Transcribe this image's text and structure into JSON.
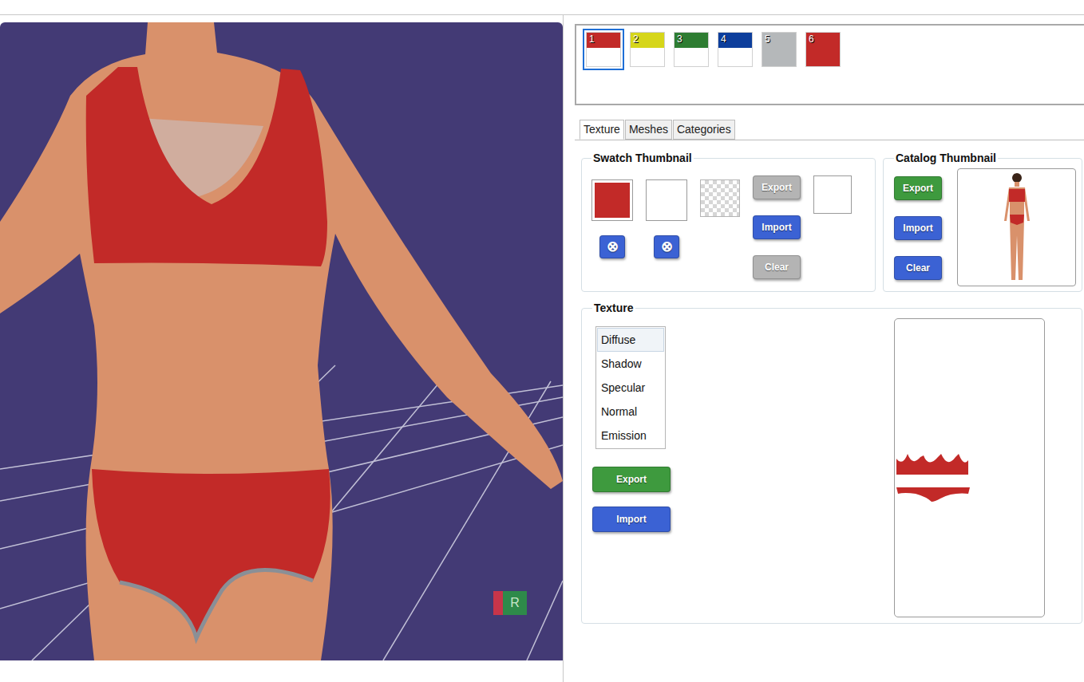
{
  "viewport": {
    "gizmo_label": "R"
  },
  "swatches": [
    {
      "number": "1",
      "color": "#c22a28",
      "color2": "#ffffff",
      "selected": true
    },
    {
      "number": "2",
      "color": "#d6d61a",
      "color2": "#ffffff",
      "selected": false
    },
    {
      "number": "3",
      "color": "#2e7d32",
      "color2": "#ffffff",
      "selected": false
    },
    {
      "number": "4",
      "color": "#0d3e9c",
      "color2": "#ffffff",
      "selected": false
    },
    {
      "number": "5",
      "color": "#b5b8ba",
      "color2": "#b5b8ba",
      "selected": false
    },
    {
      "number": "6",
      "color": "#c22a28",
      "color2": "#c22a28",
      "selected": false
    }
  ],
  "tabs": [
    {
      "label": "Texture",
      "selected": true
    },
    {
      "label": "Meshes",
      "selected": false
    },
    {
      "label": "Categories",
      "selected": false
    }
  ],
  "swatch_thumbnail": {
    "title": "Swatch Thumbnail",
    "swatch_color": "#c22a28",
    "remove_buttons": [
      {
        "label": "⊗"
      },
      {
        "label": "⊗"
      }
    ],
    "buttons": [
      {
        "label": "Export",
        "disabled": true
      },
      {
        "label": "Import",
        "disabled": false
      },
      {
        "label": "Clear",
        "disabled": true
      }
    ]
  },
  "catalog_thumbnail": {
    "title": "Catalog Thumbnail",
    "buttons": [
      {
        "label": "Export",
        "color": "#3e9a3e"
      },
      {
        "label": "Import",
        "color": "#3b62d4"
      },
      {
        "label": "Clear",
        "color": "#3b62d4"
      }
    ]
  },
  "texture": {
    "title": "Texture",
    "channels": [
      {
        "label": "Diffuse",
        "selected": true
      },
      {
        "label": "Shadow",
        "selected": false
      },
      {
        "label": "Specular",
        "selected": false
      },
      {
        "label": "Normal",
        "selected": false
      },
      {
        "label": "Emission",
        "selected": false
      }
    ],
    "buttons": [
      {
        "label": "Export",
        "color": "#3e9a3e"
      },
      {
        "label": "Import",
        "color": "#3b62d4"
      }
    ]
  }
}
